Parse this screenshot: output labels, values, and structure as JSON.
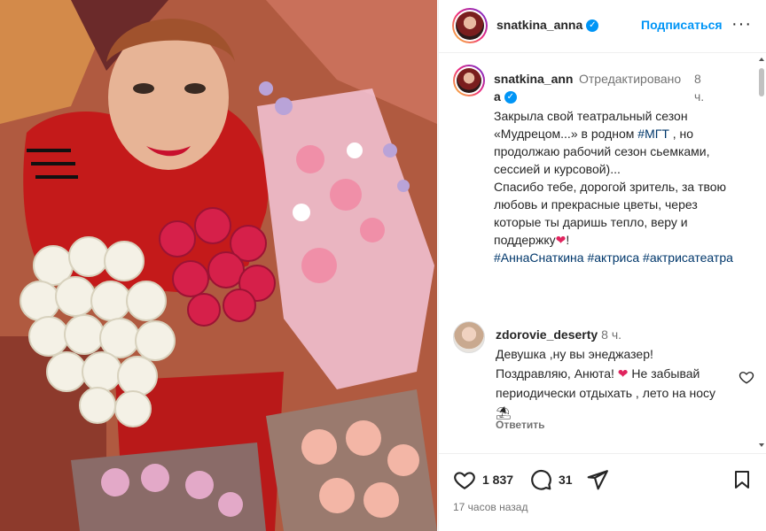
{
  "header": {
    "username": "snatkina_anna",
    "follow_label": "Подписаться",
    "more_label": "···"
  },
  "caption": {
    "username": "snatkina_anna",
    "edited_label": "Отредактировано",
    "time": "8 ч.",
    "lines": [
      "Закрыла свой театральный сезон «Мудрецом...» в родном",
      "#МГТ",
      ", но продолжаю рабочий сезон сьемками, сессией и курсовой)...",
      "Спасибо тебе, дорогой зритель, за твою любовь и прекрасные цветы, через которые ты даришь тепло, веру и поддержку",
      "❤",
      "!"
    ],
    "hashtags": [
      "#АннаСнаткина",
      "#актриса",
      "#актрисатеатра"
    ]
  },
  "comment": {
    "username": "zdorovie_deserty",
    "time": "8 ч.",
    "text_part1": "Девушка ,ну вы энеджазер! Поздравляю, Анюта!",
    "heart": "❤",
    "text_part2": "Не забывай периодически отдыхать , лето на носу",
    "emoji": "⛱",
    "reply_label": "Ответить"
  },
  "actions": {
    "likes": "1 837",
    "comments": "31",
    "posted_ago": "17 часов назад"
  },
  "colors": {
    "link": "#00376b",
    "follow": "#0095f6",
    "verified": "#0095f6",
    "muted": "#737373"
  }
}
